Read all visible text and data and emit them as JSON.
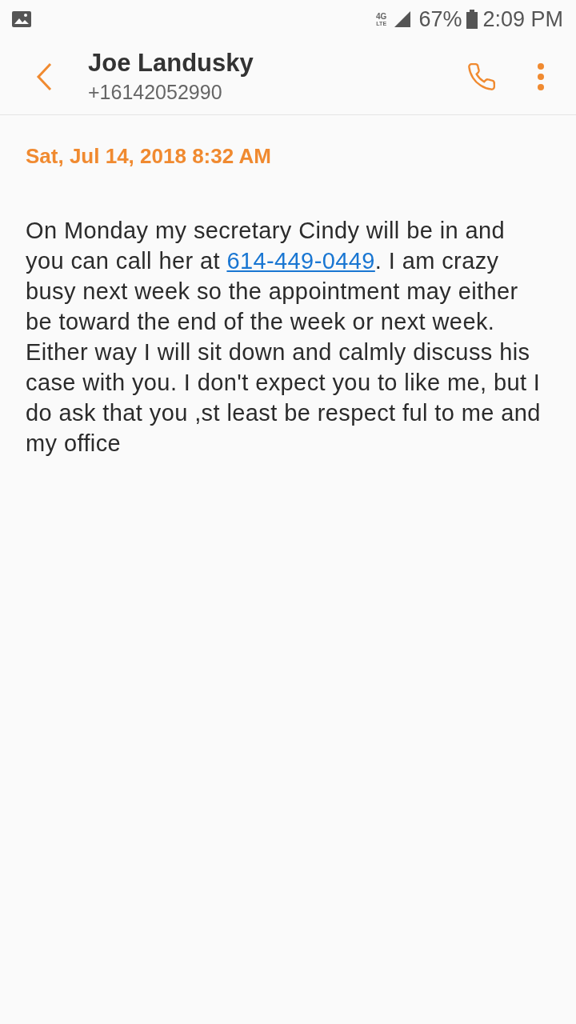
{
  "status_bar": {
    "network": "4G",
    "network_sub": "LTE",
    "battery": "67%",
    "time": "2:09 PM"
  },
  "header": {
    "name": "Joe Landusky",
    "number": "+16142052990"
  },
  "message": {
    "date": "Sat, Jul 14, 2018 8:32 AM",
    "text_before": "On Monday my secretary Cindy will be in and you can call her at ",
    "link": "614-449-0449",
    "text_after": ". I am crazy busy next week so the appointment may either be toward the end of the week or next week. Either way I will sit down and calmly discuss his case with you. I don't expect you to like me, but I do ask that you ,st least be respect ful to me and my office"
  }
}
